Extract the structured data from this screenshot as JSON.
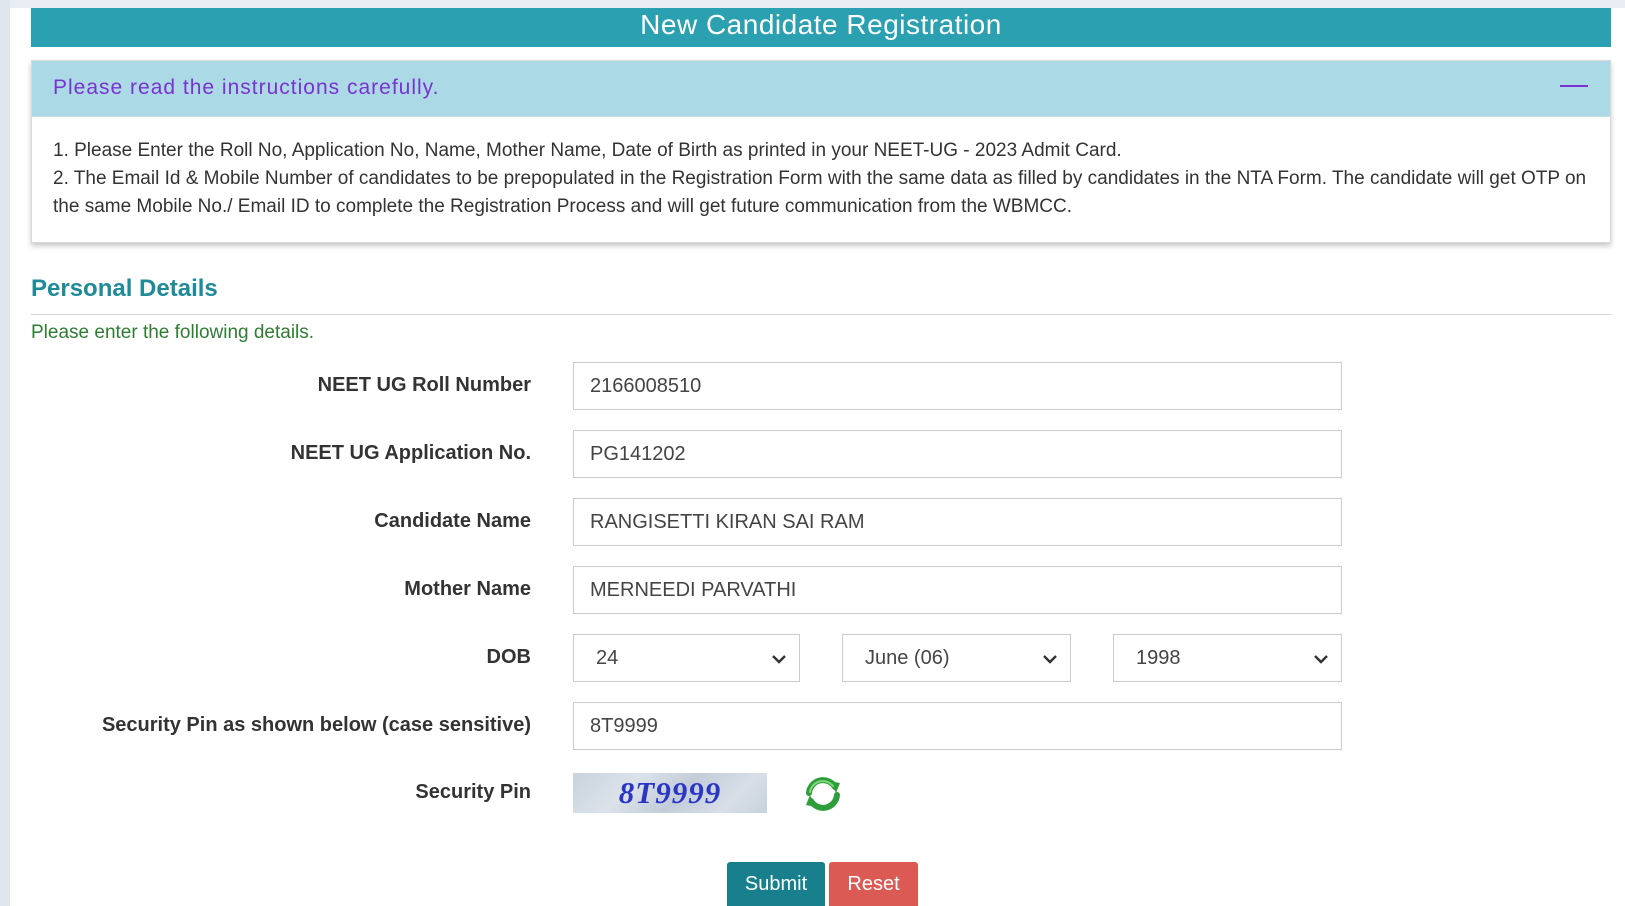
{
  "header": {
    "title": "New Candidate Registration"
  },
  "instructions": {
    "title": "Please read the instructions carefully.",
    "collapse_icon": "minus-icon",
    "lines": [
      "1. Please Enter the Roll No, Application No, Name, Mother Name, Date of Birth as printed in your NEET-UG - 2023 Admit Card.",
      "2. The Email Id & Mobile Number of candidates to be prepopulated in the Registration Form with the same data as filled by candidates in the NTA Form. The candidate will get OTP on the same Mobile No./ Email ID to complete the Registration Process and will get future communication from the WBMCC."
    ]
  },
  "section": {
    "title": "Personal Details",
    "subtitle": "Please enter the following details."
  },
  "form": {
    "roll_number": {
      "label": "NEET UG Roll Number",
      "value": "2166008510"
    },
    "application_no": {
      "label": "NEET UG Application No.",
      "value": "PG141202"
    },
    "candidate_name": {
      "label": "Candidate Name",
      "value": "RANGISETTI KIRAN SAI RAM"
    },
    "mother_name": {
      "label": "Mother Name",
      "value": "MERNEEDI PARVATHI"
    },
    "dob": {
      "label": "DOB",
      "day": "24",
      "month": "June (06)",
      "year": "1998"
    },
    "security_pin_input": {
      "label": "Security Pin as shown below (case sensitive)",
      "value": "8T9999"
    },
    "security_pin": {
      "label": "Security Pin",
      "captcha_text": "8T9999",
      "refresh_icon": "refresh-icon"
    }
  },
  "buttons": {
    "submit": "Submit",
    "reset": "Reset"
  },
  "colors": {
    "header_bg": "#2aa0b0",
    "instr_header_bg": "#acd9e6",
    "instr_title": "#7a32d0",
    "section_title": "#1f8a98",
    "subtitle": "#2e7d32",
    "submit_bg": "#17808c",
    "reset_bg": "#db5a54",
    "captcha_text": "#2a36c4"
  }
}
